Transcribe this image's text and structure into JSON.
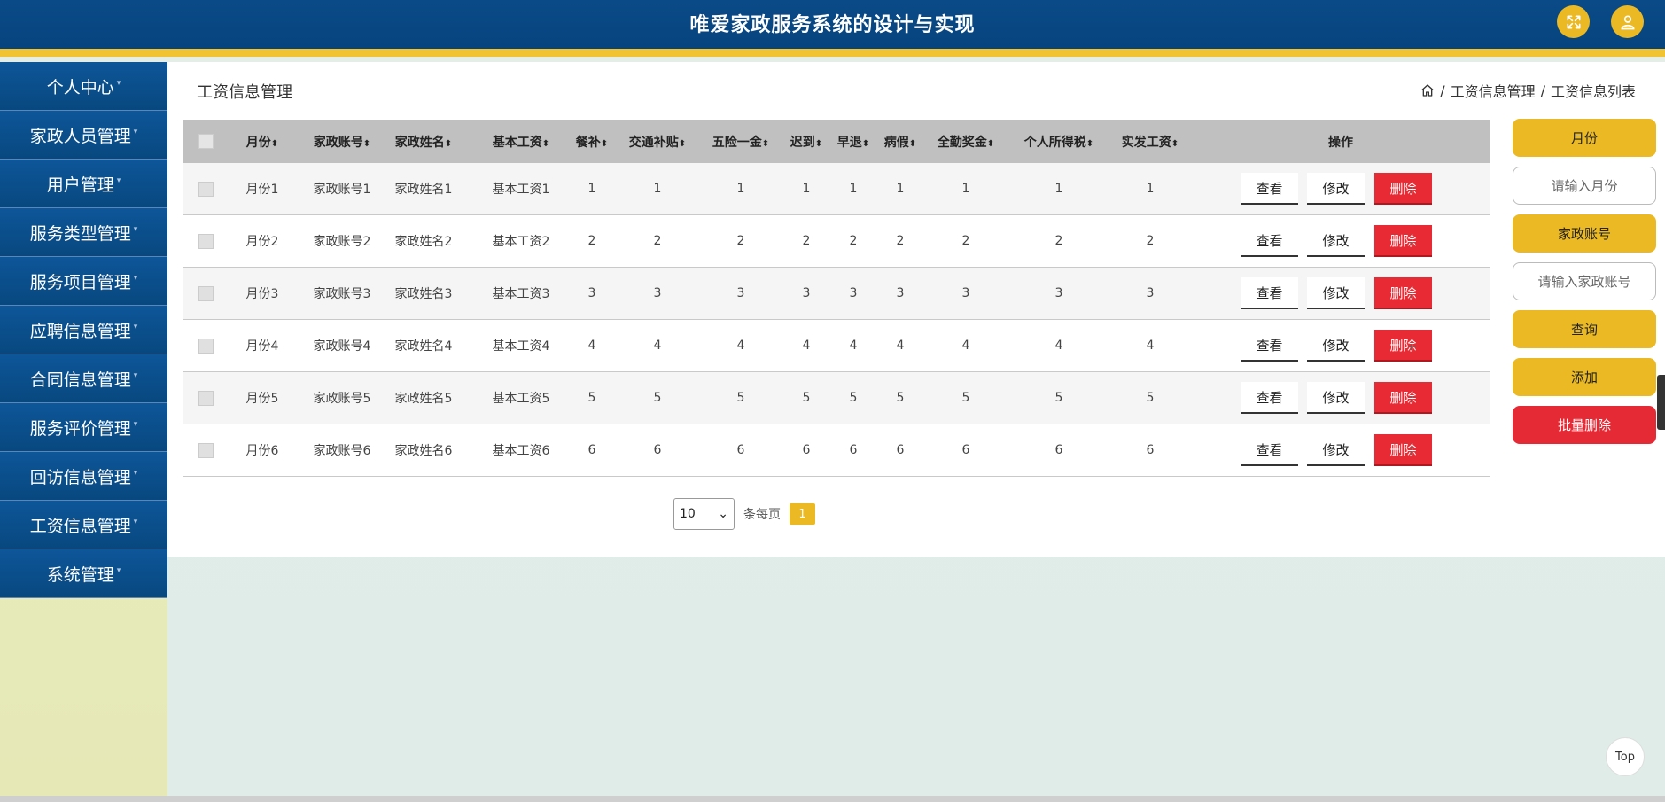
{
  "header": {
    "title": "唯爱家政服务系统的设计与实现"
  },
  "sidebar": {
    "items": [
      {
        "label": "个人中心"
      },
      {
        "label": "家政人员管理"
      },
      {
        "label": "用户管理"
      },
      {
        "label": "服务类型管理"
      },
      {
        "label": "服务项目管理"
      },
      {
        "label": "应聘信息管理"
      },
      {
        "label": "合同信息管理"
      },
      {
        "label": "服务评价管理"
      },
      {
        "label": "回访信息管理"
      },
      {
        "label": "工资信息管理"
      },
      {
        "label": "系统管理"
      }
    ]
  },
  "page": {
    "title": "工资信息管理",
    "breadcrumb": {
      "sep": "/",
      "level1": "工资信息管理",
      "level2": "工资信息列表"
    }
  },
  "table": {
    "headers": [
      "月份",
      "家政账号",
      "家政姓名",
      "基本工资",
      "餐补",
      "交通补贴",
      "五险一金",
      "迟到",
      "早退",
      "病假",
      "全勤奖金",
      "个人所得税",
      "实发工资"
    ],
    "sort_icon": "⬍",
    "action_header": "操作",
    "rows": [
      [
        "月份1",
        "家政账号1",
        "家政姓名1",
        "基本工资1",
        "1",
        "1",
        "1",
        "1",
        "1",
        "1",
        "1",
        "1",
        "1"
      ],
      [
        "月份2",
        "家政账号2",
        "家政姓名2",
        "基本工资2",
        "2",
        "2",
        "2",
        "2",
        "2",
        "2",
        "2",
        "2",
        "2"
      ],
      [
        "月份3",
        "家政账号3",
        "家政姓名3",
        "基本工资3",
        "3",
        "3",
        "3",
        "3",
        "3",
        "3",
        "3",
        "3",
        "3"
      ],
      [
        "月份4",
        "家政账号4",
        "家政姓名4",
        "基本工资4",
        "4",
        "4",
        "4",
        "4",
        "4",
        "4",
        "4",
        "4",
        "4"
      ],
      [
        "月份5",
        "家政账号5",
        "家政姓名5",
        "基本工资5",
        "5",
        "5",
        "5",
        "5",
        "5",
        "5",
        "5",
        "5",
        "5"
      ],
      [
        "月份6",
        "家政账号6",
        "家政姓名6",
        "基本工资6",
        "6",
        "6",
        "6",
        "6",
        "6",
        "6",
        "6",
        "6",
        "6"
      ]
    ],
    "actions": {
      "view": "查看",
      "edit": "修改",
      "delete": "删除"
    }
  },
  "pagination": {
    "page_size": "10",
    "per_page_label": "条每页",
    "current_page": "1"
  },
  "search": {
    "month_label": "月份",
    "month_placeholder": "请输入月份",
    "account_label": "家政账号",
    "account_placeholder": "请输入家政账号",
    "query_button": "查询",
    "add_button": "添加",
    "batch_delete_button": "批量删除"
  },
  "top_button": "Top",
  "colors": {
    "header_bg": "#06447f",
    "accent": "#ebb924",
    "danger": "#e72a33"
  }
}
